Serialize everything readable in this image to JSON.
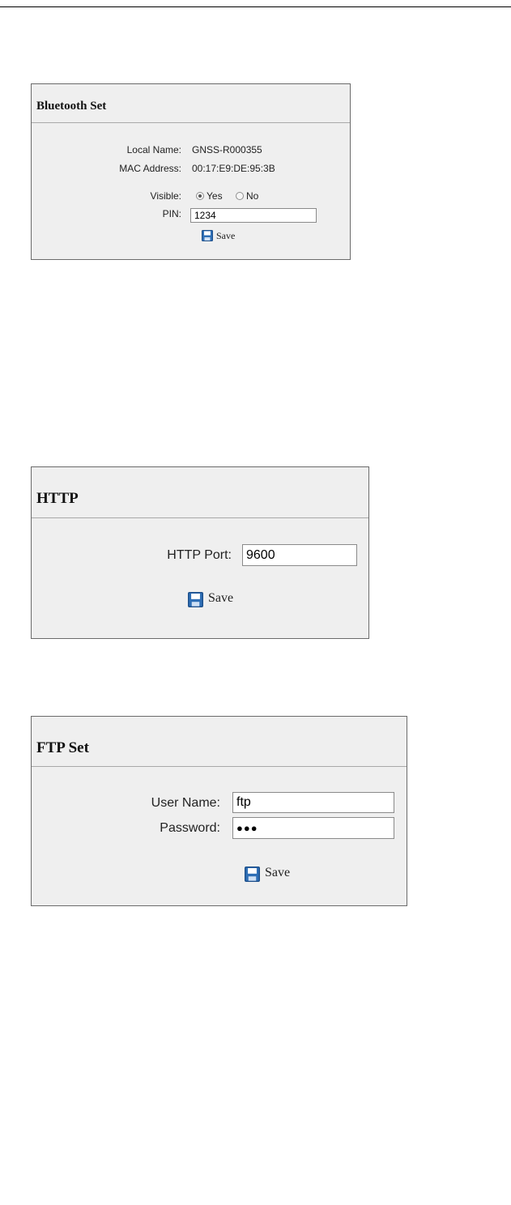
{
  "bluetooth": {
    "title": "Bluetooth Set",
    "local_name_label": "Local Name:",
    "local_name_value": "GNSS-R000355",
    "mac_label": "MAC Address:",
    "mac_value": "00:17:E9:DE:95:3B",
    "visible_label": "Visible:",
    "visible_options": [
      "Yes",
      "No"
    ],
    "visible_selected": "Yes",
    "pin_label": "PIN:",
    "pin_value": "1234",
    "save_label": "Save",
    "save_icon": "floppy-disk-icon"
  },
  "http": {
    "title": "HTTP",
    "port_label": "HTTP Port:",
    "port_value": "9600",
    "save_label": "Save",
    "save_icon": "floppy-disk-icon"
  },
  "ftp": {
    "title": "FTP Set",
    "username_label": "User Name:",
    "username_value": "ftp",
    "password_label": "Password:",
    "password_value": "●●●",
    "save_label": "Save",
    "save_icon": "floppy-disk-icon"
  },
  "colors": {
    "panel_bg": "#efefef",
    "panel_border": "#6b6b6b",
    "disk_blue": "#2f6fb6"
  }
}
